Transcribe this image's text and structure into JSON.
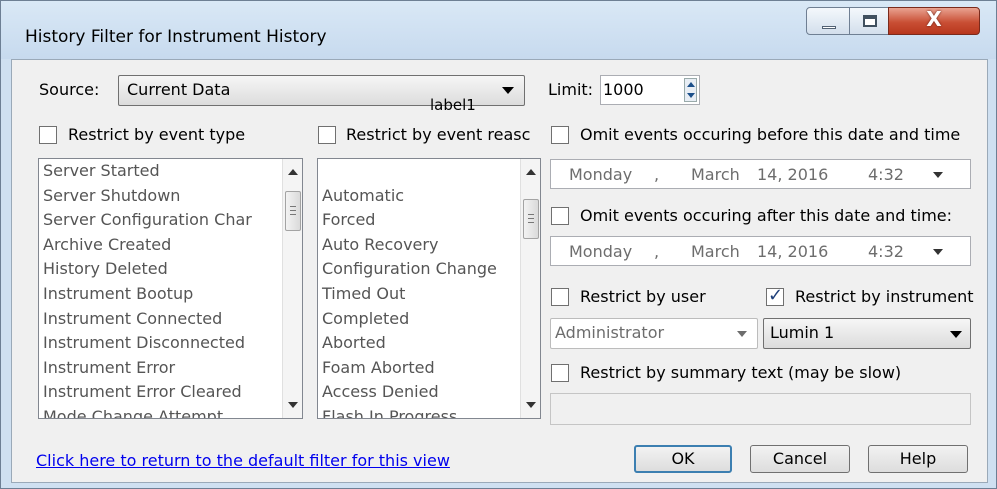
{
  "window": {
    "title": "History Filter for Instrument History",
    "close_glyph": "X"
  },
  "source": {
    "label": "Source:",
    "value": "Current Data",
    "overlay_label": "label1"
  },
  "limit": {
    "label": "Limit:",
    "value": "1000"
  },
  "event_type": {
    "label": "Restrict by event type",
    "checked": false,
    "items": [
      "Server Started",
      "Server Shutdown",
      "Server Configuration Char",
      "Archive Created",
      "History Deleted",
      "Instrument Bootup",
      "Instrument Connected",
      "Instrument Disconnected",
      "Instrument Error",
      "Instrument Error Cleared",
      "Mode Change Attempt"
    ]
  },
  "event_reason": {
    "label": "Restrict by event reasc",
    "checked": false,
    "items": [
      "",
      "Automatic",
      "Forced",
      "Auto Recovery",
      "Configuration Change",
      "Timed Out",
      "Completed",
      "Aborted",
      "Foam Aborted",
      "Access Denied",
      "Flash In Progress"
    ]
  },
  "omit_before": {
    "label": "Omit events occuring before this date and time",
    "checked": false,
    "date": {
      "weekday": "Monday",
      "sep": ",",
      "month": "March",
      "daynum": "14, 2016",
      "time": "4:32"
    }
  },
  "omit_after": {
    "label": "Omit events occuring after this date and time:",
    "checked": false,
    "date": {
      "weekday": "Monday",
      "sep": ",",
      "month": "March",
      "daynum": "14, 2016",
      "time": "4:32"
    }
  },
  "user": {
    "label": "Restrict by user",
    "checked": false,
    "value": "Administrator"
  },
  "instrument": {
    "label": "Restrict by instrument",
    "checked": true,
    "value": "Lumin 1"
  },
  "summary": {
    "label": "Restrict by summary text (may be slow)",
    "checked": false,
    "value": ""
  },
  "footer": {
    "default_link": "Click here to return to the default filter for this view",
    "ok": "OK",
    "cancel": "Cancel",
    "help": "Help"
  }
}
